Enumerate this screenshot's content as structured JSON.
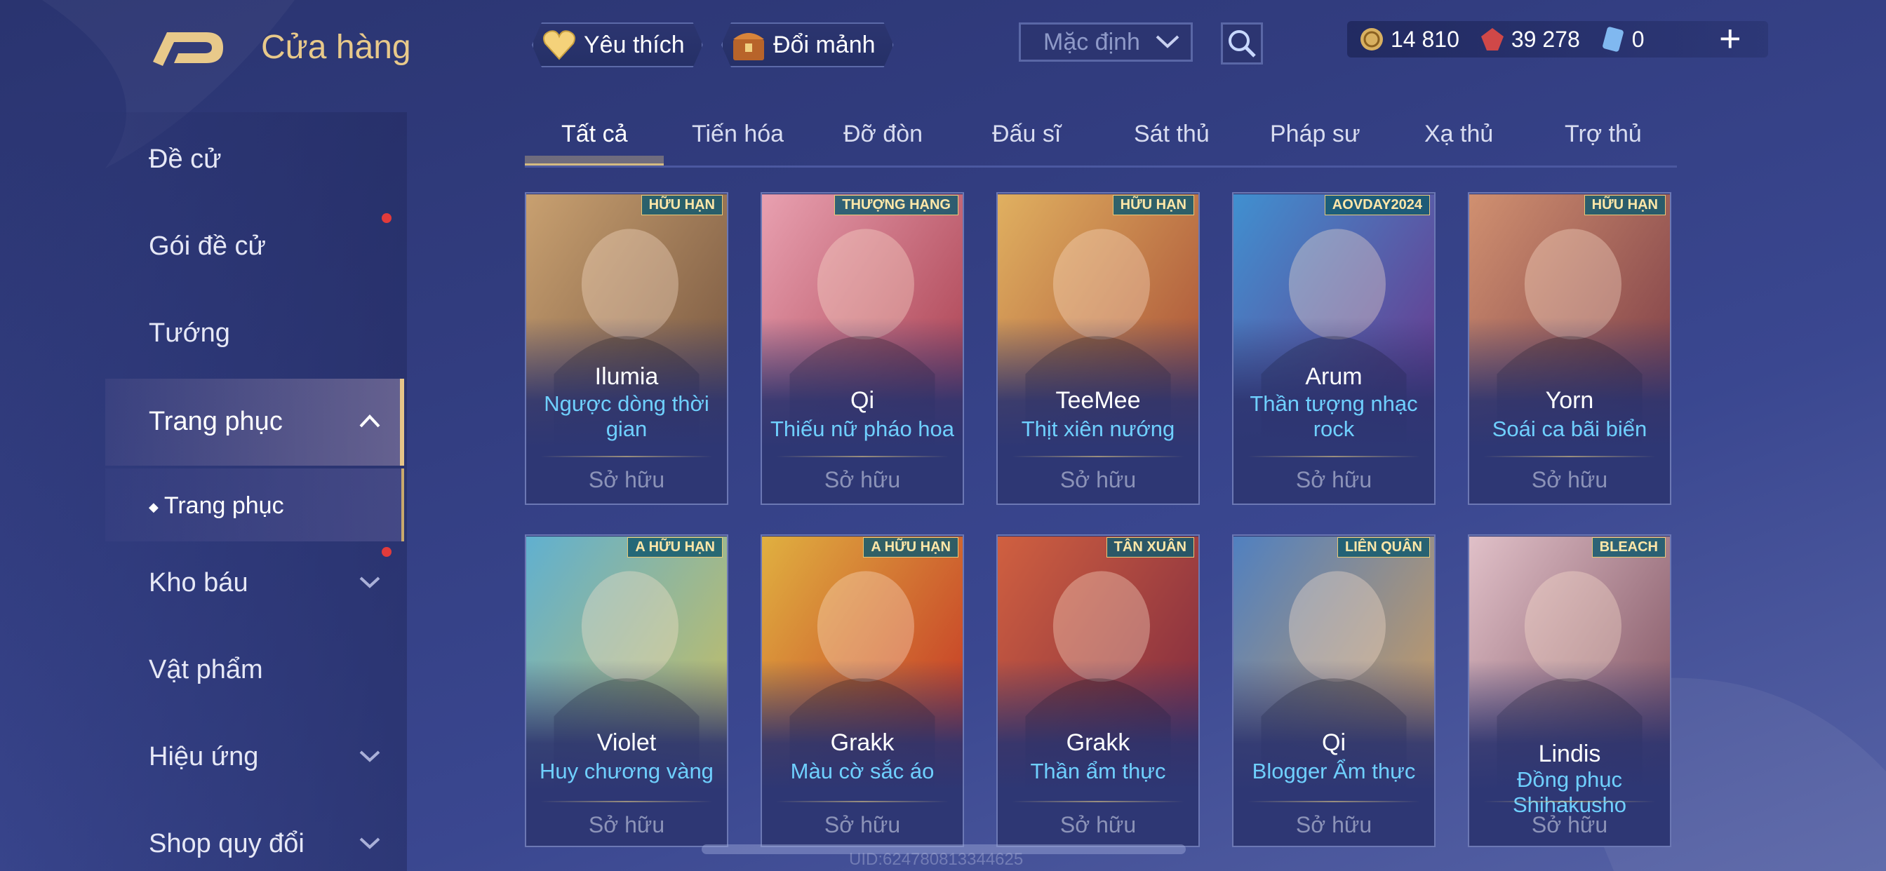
{
  "header": {
    "title": "Cửa hàng",
    "favorite_label": "Yêu thích",
    "exchange_label": "Đổi mảnh",
    "sort_value": "Mặc định",
    "currencies": [
      {
        "icon": "gold-coin-icon",
        "value": "14 810"
      },
      {
        "icon": "red-gem-icon",
        "value": "39 278"
      },
      {
        "icon": "blue-voucher-icon",
        "value": "0"
      }
    ]
  },
  "sidebar": {
    "items": [
      {
        "label": "Đề cử"
      },
      {
        "label": "Gói đề cử"
      },
      {
        "label": "Tướng"
      },
      {
        "label": "Trang phục"
      },
      {
        "label": "Trang phục"
      },
      {
        "label": "Kho báu"
      },
      {
        "label": "Vật phẩm"
      },
      {
        "label": "Hiệu ứng"
      },
      {
        "label": "Shop quy đổi"
      }
    ]
  },
  "tabs": [
    "Tất cả",
    "Tiến hóa",
    "Đỡ đòn",
    "Đấu sĩ",
    "Sát thủ",
    "Pháp sư",
    "Xạ thủ",
    "Trợ thủ"
  ],
  "cards": [
    {
      "hero": "Ilumia",
      "skin": [
        "Ngược dòng thời",
        "gian"
      ],
      "owned": "Sở hữu",
      "badge": "HỮU HẠN",
      "colors": [
        "#c8a070",
        "#6a4a38"
      ]
    },
    {
      "hero": "Qi",
      "skin": [
        "Thiếu nữ pháo hoa"
      ],
      "owned": "Sở hữu",
      "badge": "THƯỢNG HẠNG",
      "colors": [
        "#e8a0b0",
        "#a03040"
      ]
    },
    {
      "hero": "TeeMee",
      "skin": [
        "Thịt xiên nướng"
      ],
      "owned": "Sở hữu",
      "badge": "HỮU HẠN",
      "colors": [
        "#e0b060",
        "#a04030"
      ]
    },
    {
      "hero": "Arum",
      "skin": [
        "Thần tượng nhạc",
        "rock"
      ],
      "owned": "Sở hữu",
      "badge": "AOVDAY2024",
      "colors": [
        "#4090d0",
        "#702880"
      ]
    },
    {
      "hero": "Yorn",
      "skin": [
        "Soái ca bãi biển"
      ],
      "owned": "Sở hữu",
      "badge": "HỮU HẠN",
      "colors": [
        "#d09070",
        "#703040"
      ]
    },
    {
      "hero": "Violet",
      "skin": [
        "Huy chương vàng"
      ],
      "owned": "Sở hữu",
      "badge": "A HỮU HẠN",
      "colors": [
        "#60b0d0",
        "#d8c050"
      ]
    },
    {
      "hero": "Grakk",
      "skin": [
        "Màu cờ sắc áo"
      ],
      "owned": "Sở hữu",
      "badge": "A HỮU HẠN",
      "colors": [
        "#e0b040",
        "#c02020"
      ]
    },
    {
      "hero": "Grakk",
      "skin": [
        "Thần ẩm thực"
      ],
      "owned": "Sở hữu",
      "badge": "TÂN XUÂN",
      "colors": [
        "#d06040",
        "#702040"
      ]
    },
    {
      "hero": "Qi",
      "skin": [
        "Blogger Ẩm thực"
      ],
      "owned": "Sở hữu",
      "badge": "LIÊN QUÂN",
      "colors": [
        "#5080c0",
        "#e0a050"
      ]
    },
    {
      "hero": "Lindis",
      "skin": [
        "Đồng phục",
        "Shihakusho"
      ],
      "owned": "Sở hữu",
      "badge": "BLEACH",
      "colors": [
        "#e0c0c8",
        "#704050"
      ]
    }
  ],
  "footer": {
    "uid": "UID:624780813344625"
  }
}
